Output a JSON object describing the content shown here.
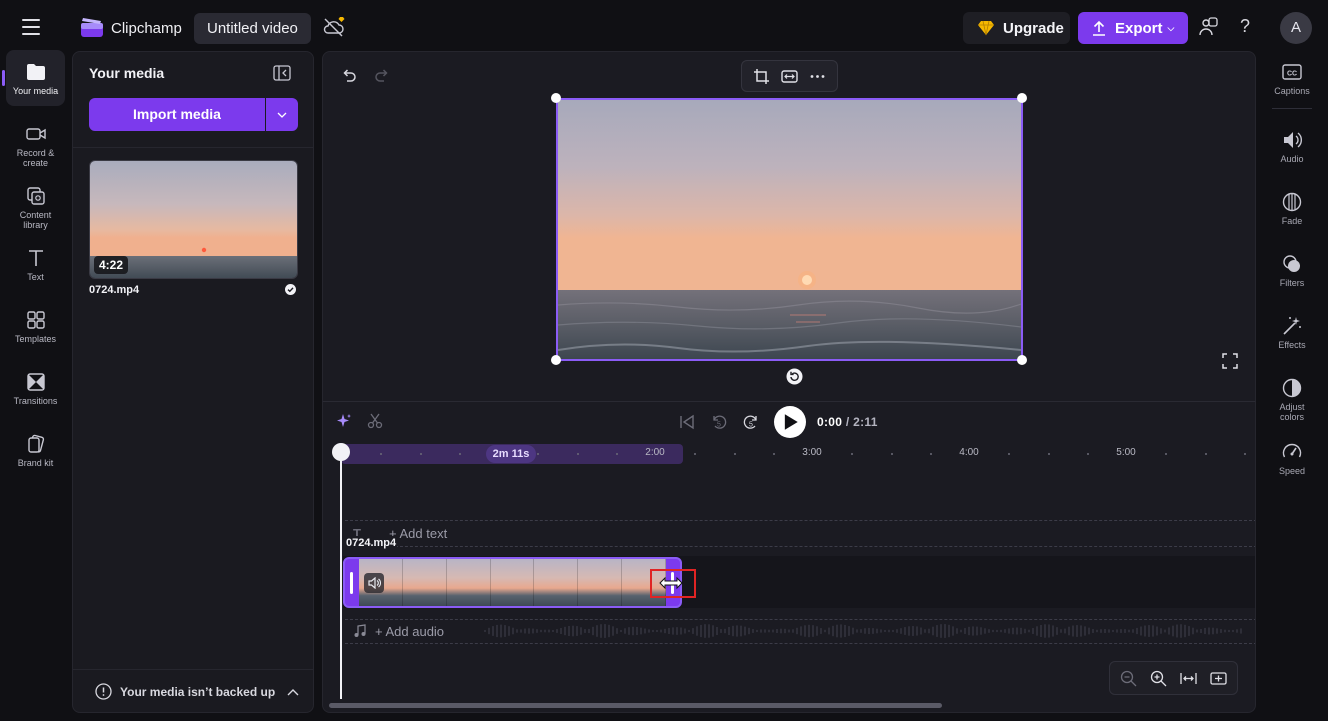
{
  "topbar": {
    "brand": "Clipchamp",
    "project_title": "Untitled video",
    "upgrade_label": "Upgrade",
    "export_label": "Export",
    "help_label": "?",
    "avatar_initial": "A"
  },
  "left_rail": {
    "items": [
      {
        "label": "Your media",
        "icon": "folder-icon",
        "active": true
      },
      {
        "label": "Record &\ncreate",
        "icon": "camera-icon"
      },
      {
        "label": "Content\nlibrary",
        "icon": "library-icon"
      },
      {
        "label": "Text",
        "icon": "text-icon"
      },
      {
        "label": "Templates",
        "icon": "templates-icon"
      },
      {
        "label": "Transitions",
        "icon": "transitions-icon"
      },
      {
        "label": "Brand kit",
        "icon": "brand-kit-icon"
      }
    ]
  },
  "media_panel": {
    "title": "Your media",
    "import_label": "Import media",
    "items": [
      {
        "name": "0724.mp4",
        "duration": "4:22"
      }
    ],
    "backup_notice": "Your media isn’t backed up"
  },
  "playback": {
    "current_time": "0:00",
    "total_time": "/ 2:11"
  },
  "timeline": {
    "duration_pill": "2m 11s",
    "tick_labels": [
      {
        "label": "2:00",
        "minute": 2
      },
      {
        "label": "3:00",
        "minute": 3
      },
      {
        "label": "4:00",
        "minute": 4
      },
      {
        "label": "5:00",
        "minute": 5
      }
    ],
    "add_text_label": "+ Add text",
    "clip_name": "0724.mp4",
    "add_audio_label": "+ Add audio"
  },
  "right_rail": {
    "items": [
      {
        "label": "Captions",
        "icon": "captions-icon"
      },
      {
        "label": "Audio",
        "icon": "audio-icon"
      },
      {
        "label": "Fade",
        "icon": "fade-icon"
      },
      {
        "label": "Filters",
        "icon": "filters-icon"
      },
      {
        "label": "Effects",
        "icon": "effects-icon"
      },
      {
        "label": "Adjust\ncolors",
        "icon": "adjust-colors-icon"
      },
      {
        "label": "Speed",
        "icon": "speed-icon"
      }
    ]
  },
  "colors": {
    "accent": "#7c3aed",
    "accent_light": "#8b5cf6",
    "background": "#101014",
    "panel": "#1a1a20",
    "highlight_red": "#e02424"
  }
}
